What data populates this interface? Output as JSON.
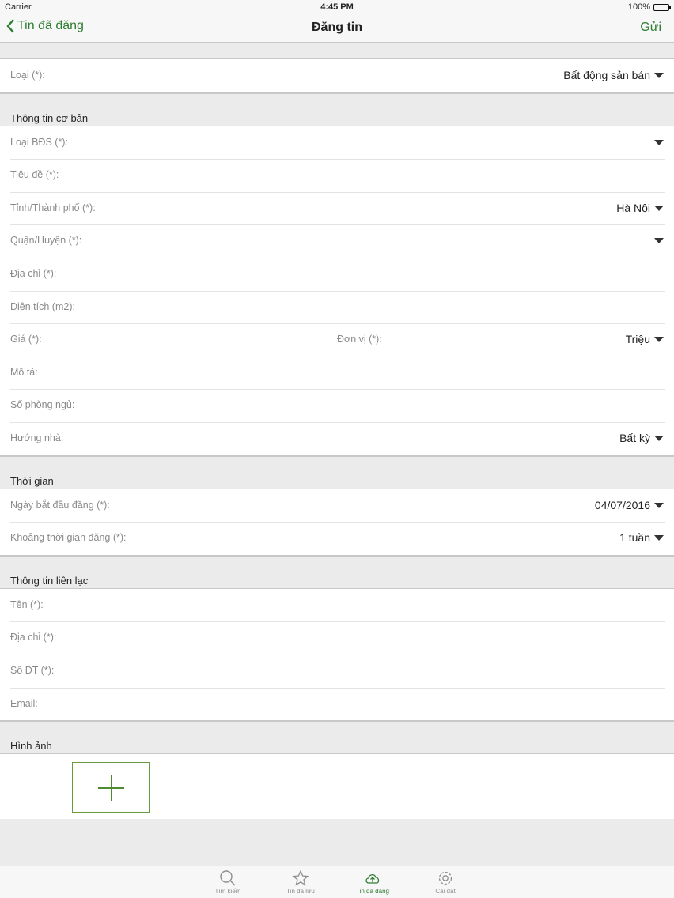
{
  "status": {
    "carrier": "Carrier",
    "time": "4:45 PM",
    "battery": "100%"
  },
  "nav": {
    "back_label": "Tin đã đăng",
    "title": "Đăng tin",
    "send_label": "Gửi",
    "accent": "#2e7d32"
  },
  "type_row": {
    "label": "Loại (*):",
    "value": "Bất động sản bán"
  },
  "basic": {
    "header": "Thông tin cơ bản",
    "property_type": {
      "label": "Loại BĐS (*):",
      "value": ""
    },
    "title": {
      "label": "Tiêu đề (*):"
    },
    "city": {
      "label": "Tỉnh/Thành phố (*):",
      "value": "Hà Nội"
    },
    "district": {
      "label": "Quận/Huyện (*):",
      "value": ""
    },
    "address": {
      "label": "Địa chỉ (*):"
    },
    "area": {
      "label": "Diện tích (m2):"
    },
    "price": {
      "label": "Giá (*):",
      "unit_label": "Đơn vị (*):",
      "unit_value": "Triệu"
    },
    "description": {
      "label": "Mô tả:"
    },
    "bedrooms": {
      "label": "Số phòng ngủ:"
    },
    "direction": {
      "label": "Hướng nhà:",
      "value": "Bất kỳ"
    }
  },
  "time": {
    "header": "Thời gian",
    "start_date": {
      "label": "Ngày bắt đầu đăng (*):",
      "value": "04/07/2016"
    },
    "duration": {
      "label": "Khoảng thời gian đăng (*):",
      "value": "1 tuần"
    }
  },
  "contact": {
    "header": "Thông tin liên lạc",
    "name": {
      "label": "Tên (*):"
    },
    "address": {
      "label": "Địa chỉ (*):"
    },
    "phone": {
      "label": "Số ĐT (*):"
    },
    "email": {
      "label": "Email:"
    }
  },
  "images": {
    "header": "Hình ảnh"
  },
  "tabs": [
    {
      "label": "Tìm kiếm",
      "icon": "search-icon"
    },
    {
      "label": "Tin đã lưu",
      "icon": "star-icon"
    },
    {
      "label": "Tin đã đăng",
      "icon": "cloud-upload-icon",
      "active": true
    },
    {
      "label": "Cài đặt",
      "icon": "gear-icon"
    }
  ]
}
